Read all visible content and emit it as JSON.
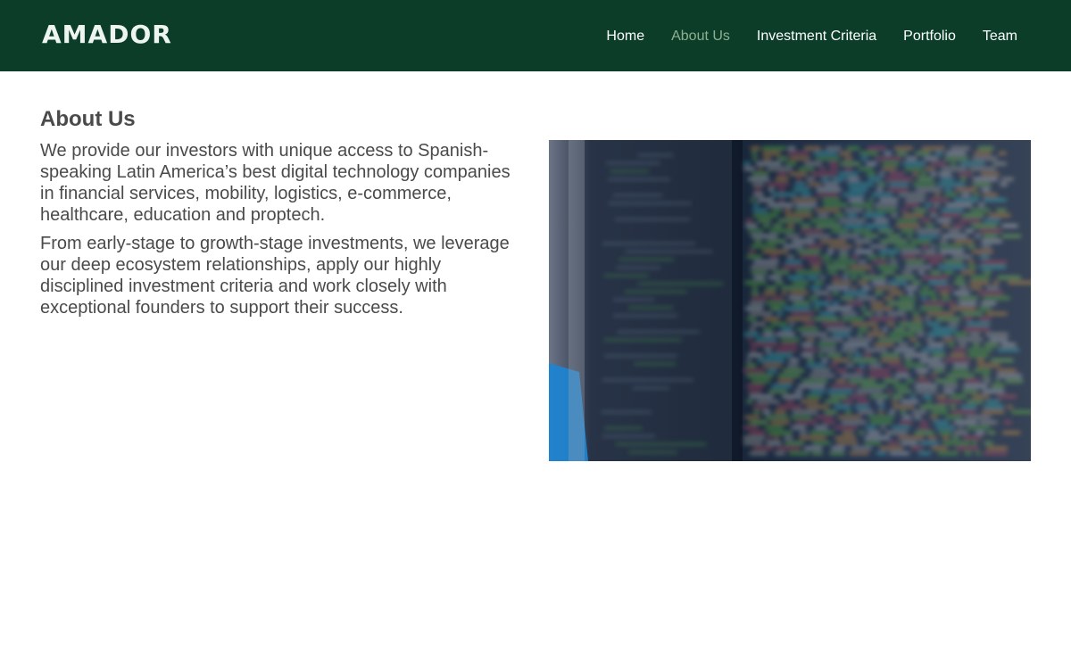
{
  "header": {
    "logo": "AMADOR",
    "nav": [
      {
        "label": "Home",
        "active": false
      },
      {
        "label": "About Us",
        "active": true
      },
      {
        "label": "Investment Criteria",
        "active": false
      },
      {
        "label": "Portfolio",
        "active": false
      },
      {
        "label": "Team",
        "active": false
      }
    ]
  },
  "main": {
    "heading": "About Us",
    "paragraphs": [
      "We provide our investors with unique access to Spanish-speaking Latin America’s best digital technology companies in financial services, mobility, logistics, e-commerce, healthcare, education and proptech.",
      "From early-stage to growth-stage investments, we leverage our deep ecosystem relationships, apply our highly disciplined investment criteria and work closely with exceptional founders to support their success."
    ]
  },
  "colors": {
    "header_bg": "#0b3d29",
    "nav_active": "#8fb08f",
    "text": "#4a4a4a"
  }
}
